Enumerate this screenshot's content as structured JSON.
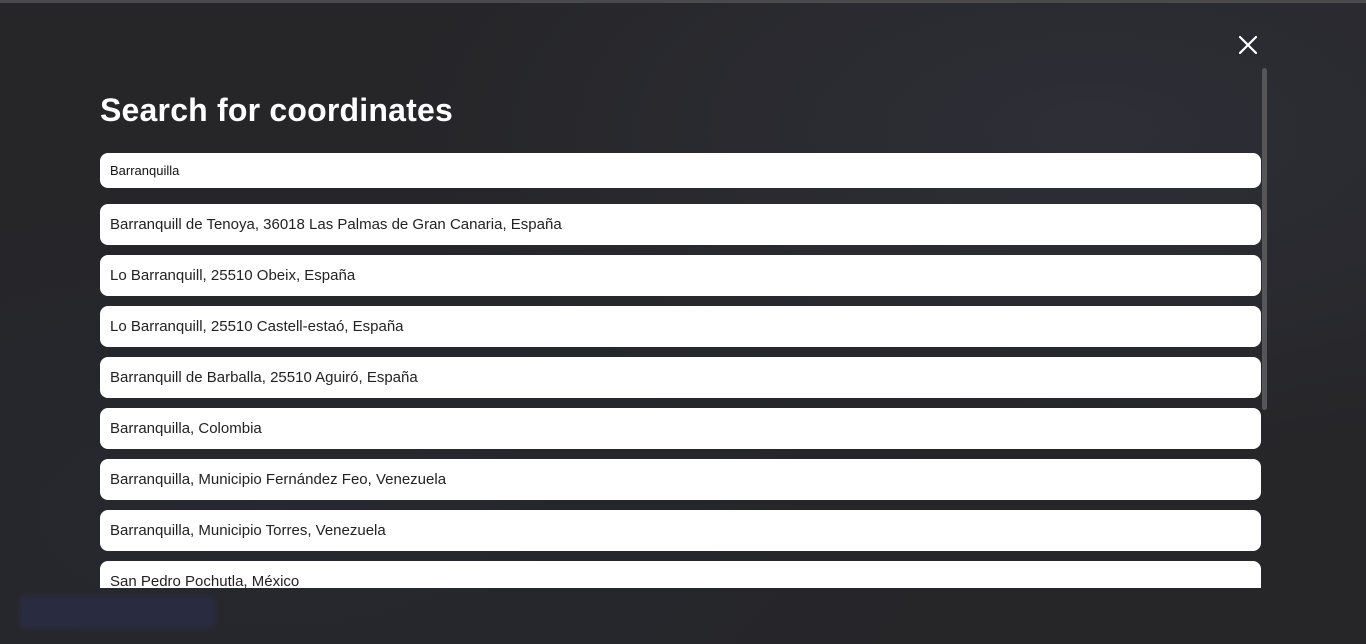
{
  "dialog": {
    "title": "Search for coordinates",
    "close_icon": "close-icon"
  },
  "search": {
    "value": "Barranquilla",
    "placeholder": ""
  },
  "results": [
    "Barranquill de Tenoya, 36018 Las Palmas de Gran Canaria, España",
    "Lo Barranquill, 25510 Obeix, España",
    "Lo Barranquill, 25510 Castell-estaó, España",
    "Barranquill de Barballa, 25510 Aguiró, España",
    "Barranquilla, Colombia",
    "Barranquilla, Municipio Fernández Feo, Venezuela",
    "Barranquilla, Municipio Torres, Venezuela",
    "San Pedro Pochutla, México"
  ],
  "colors": {
    "overlay": "#232326",
    "card": "#ffffff",
    "text": "#222222"
  }
}
